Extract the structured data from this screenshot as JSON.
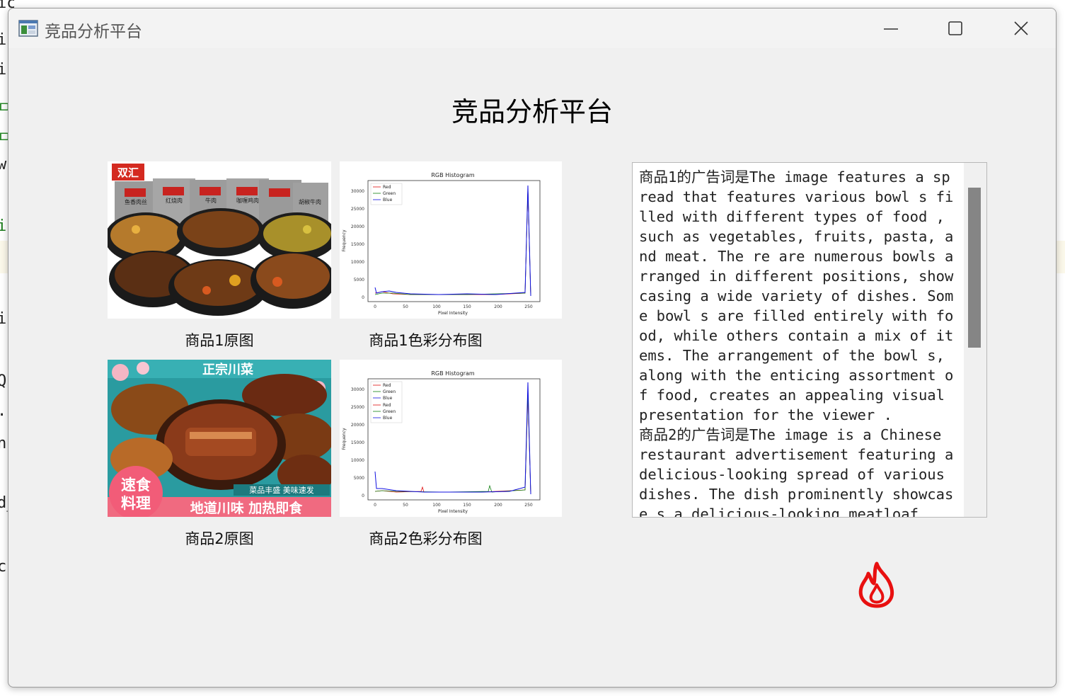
{
  "window": {
    "title": "竞品分析平台"
  },
  "background_code": [
    "icement",
    "i",
    "i",
    "ㅁ",
    "ㅁ",
    "w",
    "i",
    "i",
    "Q",
    ".(",
    "n",
    "d_",
    "c."
  ],
  "main": {
    "heading": "竞品分析平台",
    "products": [
      {
        "image_caption": "商品1原图",
        "histogram_caption": "商品1色彩分布图",
        "brand_badge": "双汇",
        "pack_labels": [
          "鱼香肉丝",
          "红烧肉",
          "牛肉",
          "咖喱鸡肉",
          "胡椒牛肉"
        ],
        "histogram": {
          "title": "RGB Histogram",
          "xlabel": "Pixel Intensity",
          "ylabel": "Frequency",
          "legend": [
            "Red",
            "Green",
            "Blue"
          ]
        }
      },
      {
        "image_caption": "商品2原图",
        "histogram_caption": "商品2色彩分布图",
        "banner_top": "正宗川菜",
        "badge_line1": "速食",
        "badge_line2": "料理",
        "tagline": "菜品丰盛 美味速发",
        "banner_bottom": "地道川味 加热即食",
        "histogram": {
          "title": "RGB Histogram",
          "xlabel": "Pixel Intensity",
          "ylabel": "Frequency",
          "legend": [
            "Red",
            "Green",
            "Blue",
            "Red",
            "Green",
            "Blue"
          ]
        }
      }
    ],
    "histogram_axes": {
      "xticks": [
        "0",
        "50",
        "100",
        "150",
        "200",
        "250"
      ],
      "yticks": [
        "0",
        "5000",
        "10000",
        "15000",
        "20000",
        "25000",
        "30000"
      ]
    },
    "ad_text": "商品1的广告词是The image features a spread that features various bowl s filled with different types of food , such as vegetables, fruits, pasta, and meat. The re are numerous bowls arranged in different positions, showcasing a wide variety of dishes. Some bowl s are filled entirely with food, while others contain a mix of items. The arrangement of the bowl s, along with the enticing assortment of food, creates an appealing visual presentation for the viewer .\n商品2的广告词是The image is a Chinese restaurant advertisement featuring a delicious-looking spread of various dishes. The dish prominently showcase s a delicious-looking meatloaf"
  },
  "icons": {
    "app": "app-window-icon",
    "fire": "fire-icon",
    "fire_color": "#e81010"
  }
}
